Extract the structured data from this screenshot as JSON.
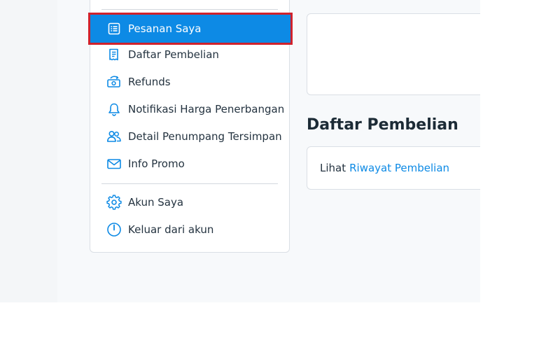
{
  "sidebar": {
    "items": [
      {
        "label": "Pesanan Saya",
        "icon": "list-icon",
        "active": true
      },
      {
        "label": "Daftar Pembelian",
        "icon": "receipt-icon",
        "active": false
      },
      {
        "label": "Refunds",
        "icon": "refund-icon",
        "active": false
      },
      {
        "label": "Notifikasi Harga Penerbangan",
        "icon": "bell-icon",
        "active": false
      },
      {
        "label": "Detail Penumpang Tersimpan",
        "icon": "users-icon",
        "active": false
      },
      {
        "label": "Info Promo",
        "icon": "mail-icon",
        "active": false
      }
    ],
    "account_items": [
      {
        "label": "Akun Saya",
        "icon": "gear-icon"
      },
      {
        "label": "Keluar dari akun",
        "icon": "power-icon"
      }
    ]
  },
  "main": {
    "section_title": "Daftar Pembelian",
    "history_prefix": "Lihat",
    "history_link": "Riwayat Pembelian"
  },
  "colors": {
    "accent": "#0d8ae5",
    "highlight_border": "#d0222c",
    "text": "#243340",
    "page_bg": "#f7f9fb"
  }
}
